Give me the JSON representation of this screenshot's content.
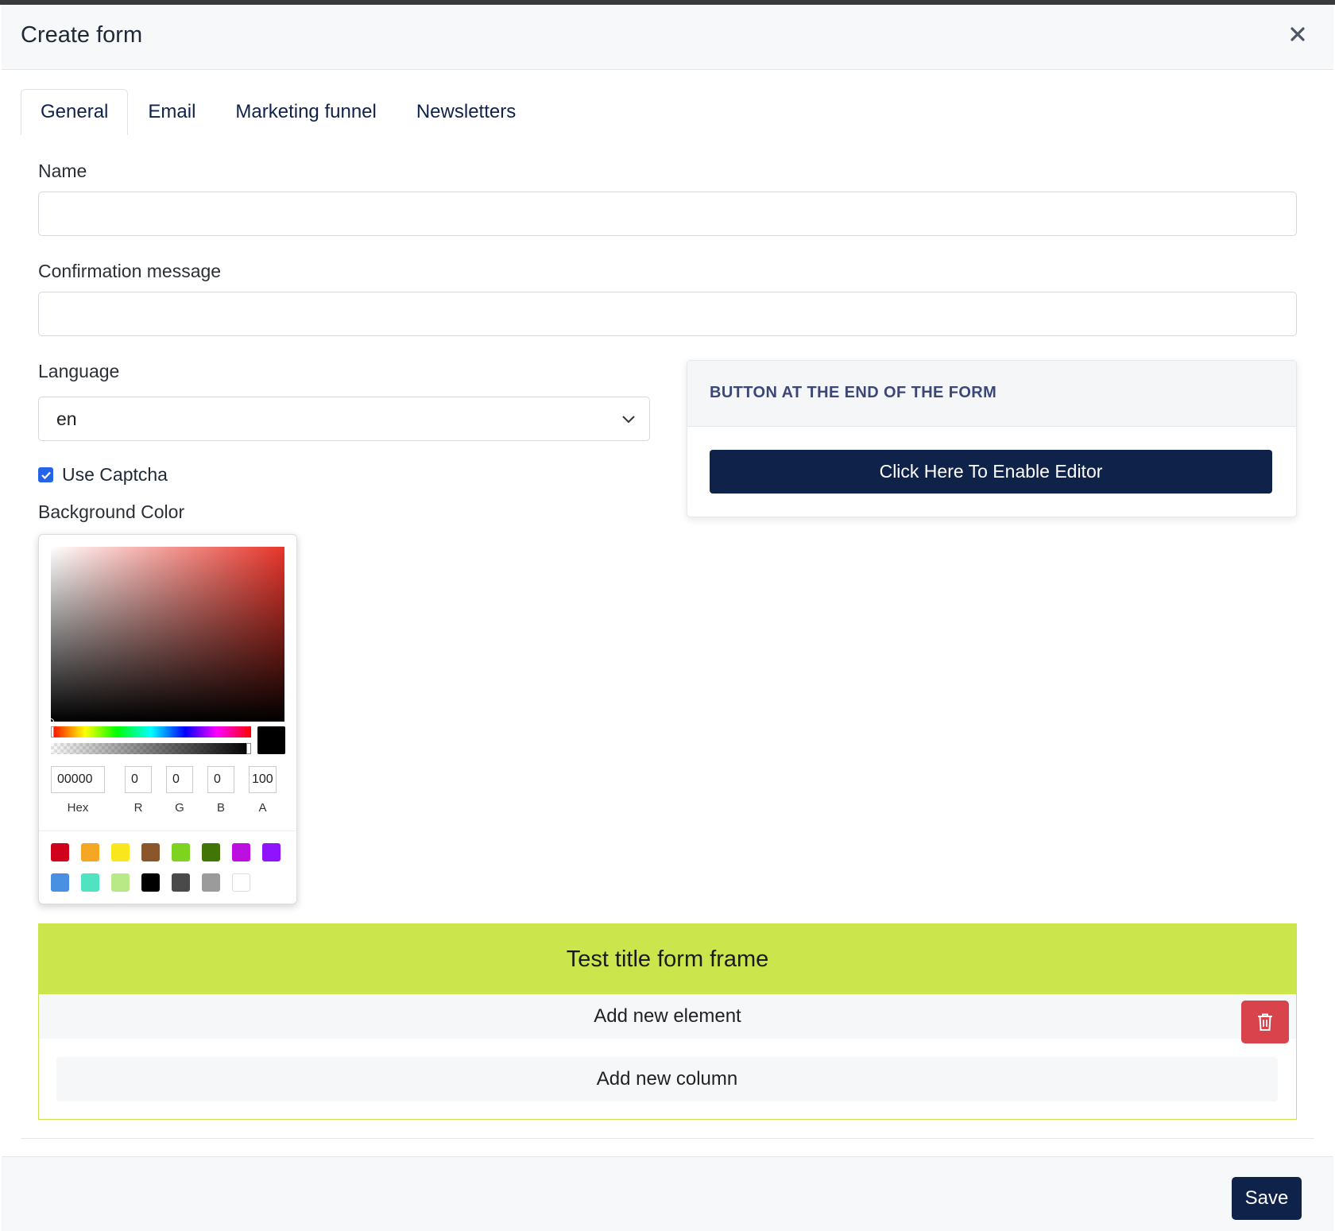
{
  "modal": {
    "title": "Create form",
    "close_icon": "close-icon"
  },
  "tabs": [
    {
      "label": "General",
      "active": true
    },
    {
      "label": "Email",
      "active": false
    },
    {
      "label": "Marketing funnel",
      "active": false
    },
    {
      "label": "Newsletters",
      "active": false
    }
  ],
  "fields": {
    "name_label": "Name",
    "name_value": "",
    "confirmation_label": "Confirmation message",
    "confirmation_value": "",
    "language_label": "Language",
    "language_value": "en",
    "captcha_label": "Use Captcha",
    "captcha_checked": true,
    "background_label": "Background Color"
  },
  "color_picker": {
    "hex": "00000",
    "r": "0",
    "g": "0",
    "b": "0",
    "a": "100",
    "labels": {
      "hex": "Hex",
      "r": "R",
      "g": "G",
      "b": "B",
      "a": "A"
    },
    "current_color": "#000000",
    "presets": [
      "#d0021b",
      "#f5a623",
      "#f8e71c",
      "#8b572a",
      "#7ed321",
      "#417505",
      "#bd10e0",
      "#9013fe",
      "#4a90e2",
      "#50e3c2",
      "#b8e986",
      "#000000",
      "#4a4a4a",
      "#9b9b9b",
      "#ffffff"
    ]
  },
  "button_panel": {
    "title": "BUTTON AT THE END OF THE FORM",
    "enable_editor_label": "Click Here To Enable Editor"
  },
  "form_frame": {
    "title": "Test title form frame",
    "title_color": "#cbe54c",
    "add_element_label": "Add new element",
    "add_column_label": "Add new column",
    "delete_icon": "trash-icon"
  },
  "footer": {
    "save_label": "Save"
  }
}
